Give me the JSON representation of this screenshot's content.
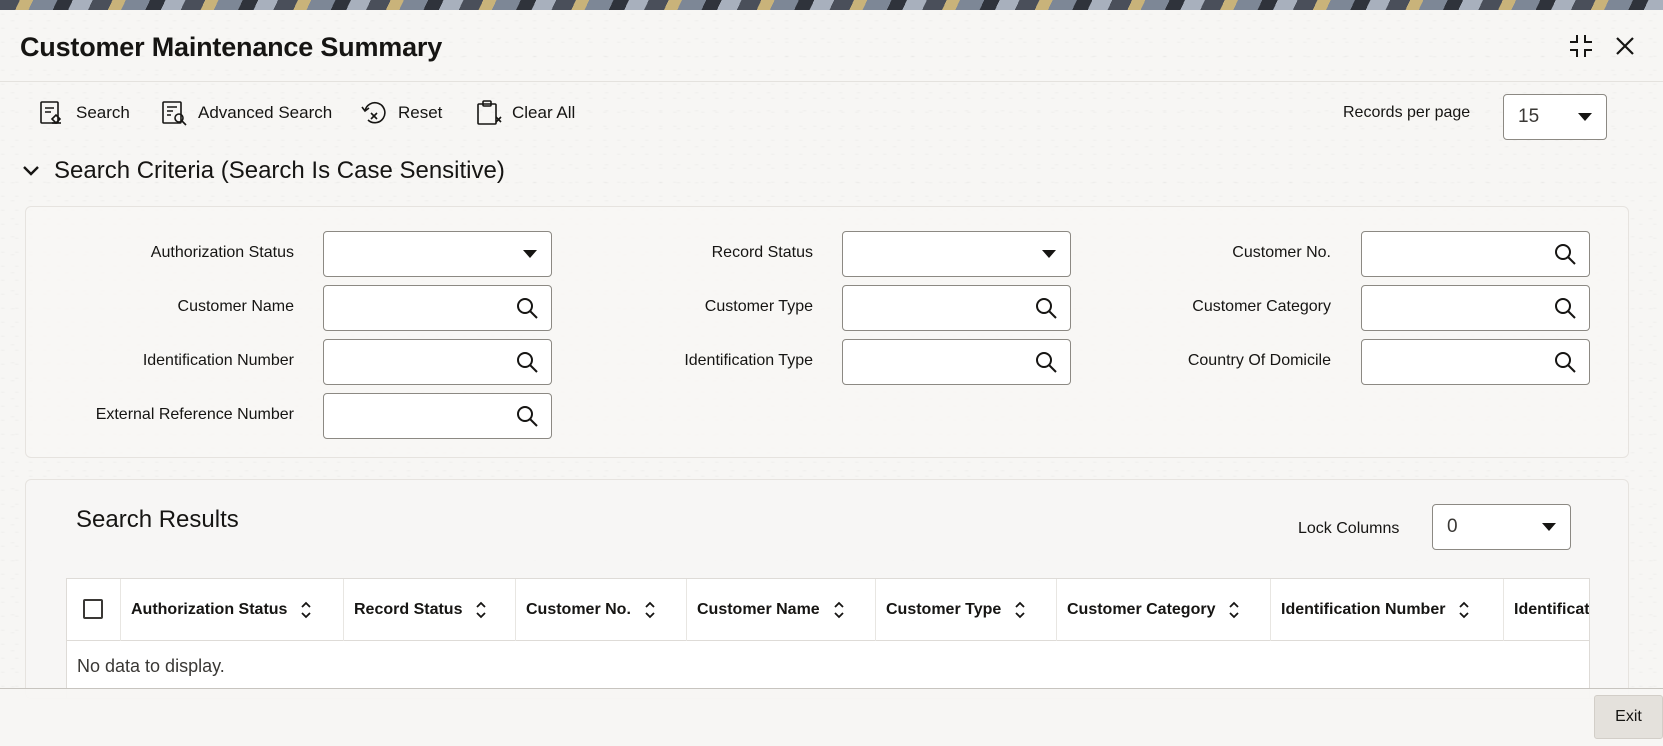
{
  "window": {
    "title": "Customer Maintenance Summary"
  },
  "toolbar": {
    "search_label": "Search",
    "advanced_search_label": "Advanced Search",
    "reset_label": "Reset",
    "clear_all_label": "Clear All",
    "records_per_page_label": "Records per page",
    "records_per_page_value": "15"
  },
  "criteria": {
    "title": "Search Criteria (Search Is Case Sensitive)",
    "fields": {
      "authorization_status": "Authorization Status",
      "record_status": "Record Status",
      "customer_no": "Customer No.",
      "customer_name": "Customer Name",
      "customer_type": "Customer Type",
      "customer_category": "Customer Category",
      "identification_number": "Identification Number",
      "identification_type": "Identification Type",
      "country_of_domicile": "Country Of Domicile",
      "external_reference_number": "External Reference Number"
    }
  },
  "results": {
    "title": "Search Results",
    "lock_columns_label": "Lock Columns",
    "lock_columns_value": "0",
    "columns": [
      "Authorization Status",
      "Record Status",
      "Customer No.",
      "Customer Name",
      "Customer Type",
      "Customer Category",
      "Identification Number",
      "Identificat"
    ],
    "empty_message": "No data to display."
  },
  "footer": {
    "exit_label": "Exit"
  },
  "icons": {
    "search": "search-icon",
    "advanced_search": "advanced-search-icon",
    "reset": "reset-icon",
    "clear_all": "clear-all-icon",
    "minimize": "collapse-window-icon",
    "close": "close-icon",
    "chevron": "chevron-down-icon",
    "sort": "sort-icon"
  }
}
